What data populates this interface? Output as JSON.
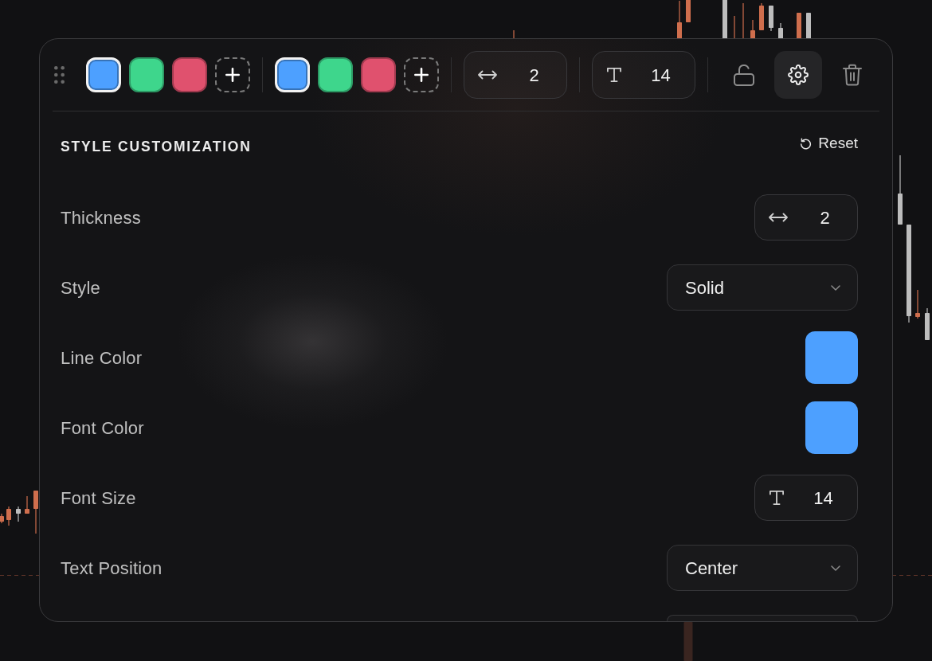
{
  "toolbar": {
    "swatch_groups": [
      {
        "swatches": [
          {
            "color": "#4da0ff",
            "selected": true
          },
          {
            "color": "#3ed68c",
            "selected": false
          },
          {
            "color": "#e0516e",
            "selected": false
          }
        ]
      },
      {
        "swatches": [
          {
            "color": "#4da0ff",
            "selected": true
          },
          {
            "color": "#3ed68c",
            "selected": false
          },
          {
            "color": "#e0516e",
            "selected": false
          }
        ]
      }
    ],
    "steppers": [
      {
        "kind": "thickness",
        "value": "2"
      },
      {
        "kind": "fontsize",
        "value": "14"
      }
    ],
    "actions": [
      {
        "kind": "lock",
        "locked": false
      },
      {
        "kind": "settings",
        "active": true
      },
      {
        "kind": "delete"
      }
    ]
  },
  "panel": {
    "title": "STYLE CUSTOMIZATION",
    "reset": {
      "label": "Reset"
    },
    "rows": [
      {
        "kind": "thickness",
        "label": "Thickness",
        "value": "2"
      },
      {
        "kind": "select",
        "label": "Style",
        "value": "Solid"
      },
      {
        "kind": "color",
        "label": "Line Color",
        "color": "#4da0ff"
      },
      {
        "kind": "color",
        "label": "Font Color",
        "color": "#4da0ff"
      },
      {
        "kind": "fontsize",
        "label": "Font Size",
        "value": "14"
      },
      {
        "kind": "select",
        "label": "Text Position",
        "value": "Center"
      },
      {
        "kind": "select"
      }
    ]
  }
}
